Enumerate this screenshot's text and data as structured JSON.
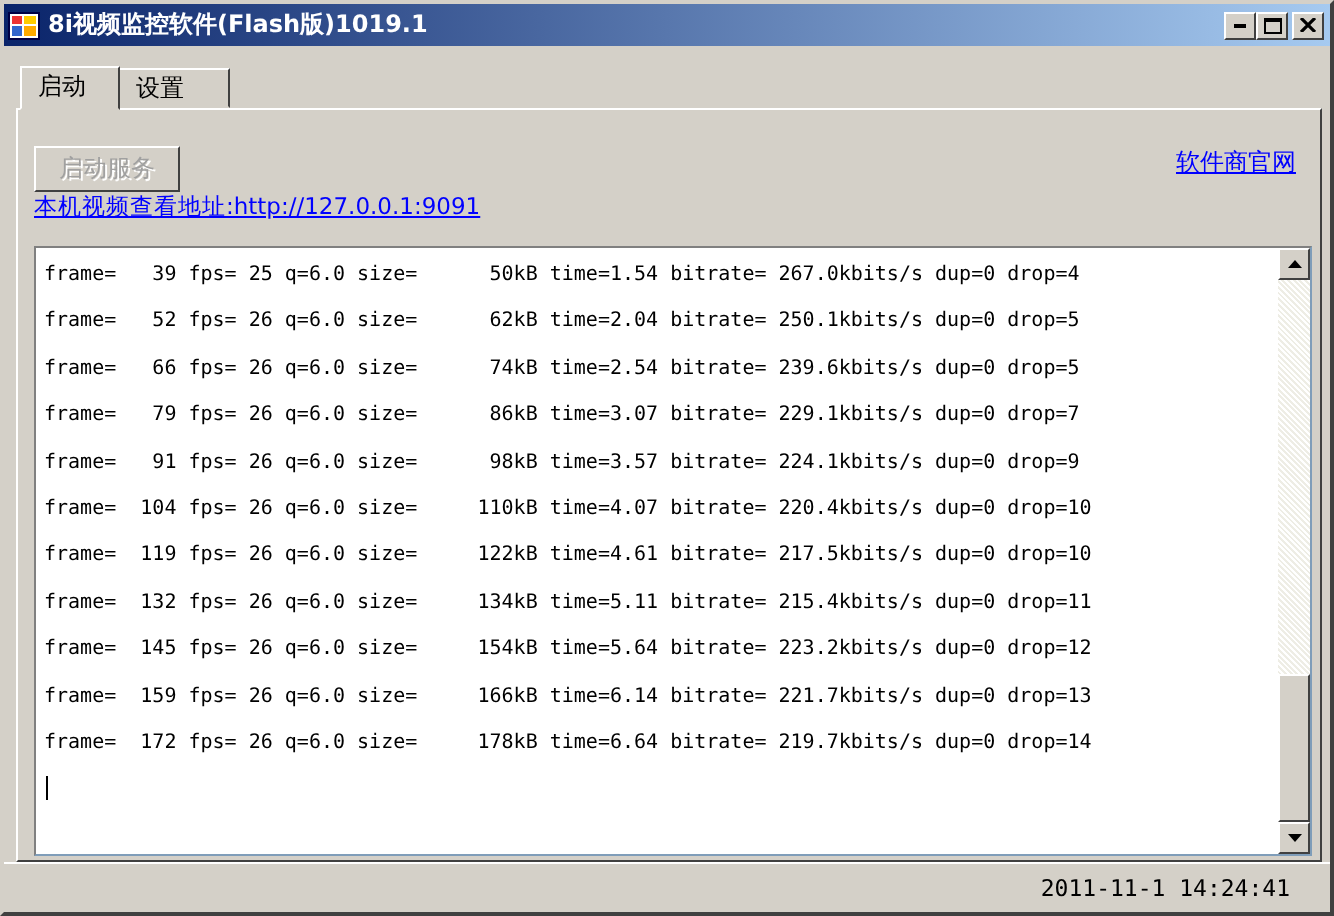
{
  "window": {
    "title": "8i视频监控软件(Flash版)1019.1"
  },
  "tabs": [
    {
      "label": "启动",
      "selected": true
    },
    {
      "label": "设置",
      "selected": false
    }
  ],
  "start_button": {
    "label": "启动服务",
    "disabled": true
  },
  "website_link": "软件商官网",
  "address_link": "本机视频查看地址:http://127.0.0.1:9091",
  "log": {
    "lines": [
      "frame=   39 fps= 25 q=6.0 size=      50kB time=1.54 bitrate= 267.0kbits/s dup=0 drop=4",
      "frame=   52 fps= 26 q=6.0 size=      62kB time=2.04 bitrate= 250.1kbits/s dup=0 drop=5",
      "frame=   66 fps= 26 q=6.0 size=      74kB time=2.54 bitrate= 239.6kbits/s dup=0 drop=5",
      "frame=   79 fps= 26 q=6.0 size=      86kB time=3.07 bitrate= 229.1kbits/s dup=0 drop=7",
      "frame=   91 fps= 26 q=6.0 size=      98kB time=3.57 bitrate= 224.1kbits/s dup=0 drop=9",
      "frame=  104 fps= 26 q=6.0 size=     110kB time=4.07 bitrate= 220.4kbits/s dup=0 drop=10",
      "frame=  119 fps= 26 q=6.0 size=     122kB time=4.61 bitrate= 217.5kbits/s dup=0 drop=10",
      "frame=  132 fps= 26 q=6.0 size=     134kB time=5.11 bitrate= 215.4kbits/s dup=0 drop=11",
      "frame=  145 fps= 26 q=6.0 size=     154kB time=5.64 bitrate= 223.2kbits/s dup=0 drop=12",
      "frame=  159 fps= 26 q=6.0 size=     166kB time=6.14 bitrate= 221.7kbits/s dup=0 drop=13",
      "frame=  172 fps= 26 q=6.0 size=     178kB time=6.64 bitrate= 219.7kbits/s dup=0 drop=14"
    ]
  },
  "status_bar": {
    "time": "2011-11-1 14:24:41"
  }
}
